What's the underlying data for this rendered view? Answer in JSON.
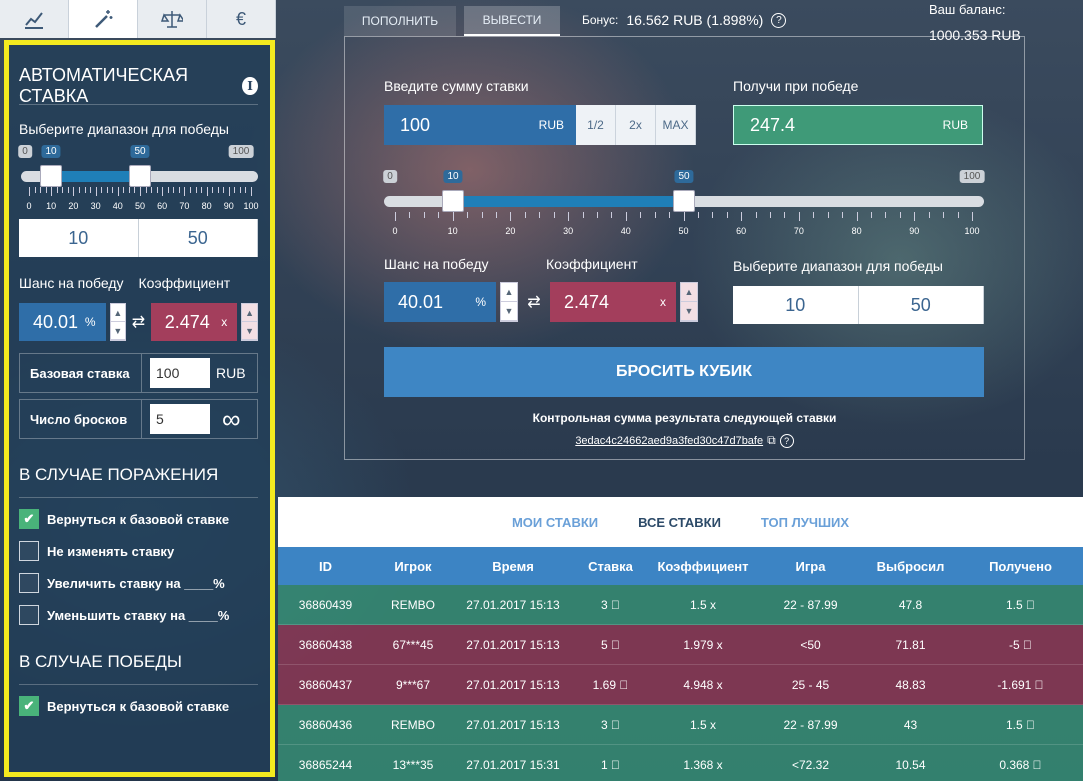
{
  "top_tabs": [
    {
      "icon": "chart-icon"
    },
    {
      "icon": "magic-wand-icon"
    },
    {
      "icon": "scales-icon"
    },
    {
      "icon": "euro-icon",
      "label": "€"
    }
  ],
  "sidebar": {
    "title": "АВТОМАТИЧЕСКАЯ СТАВКА",
    "range_label": "Выберите диапазон для победы",
    "range_min_label": "0",
    "range_max_label": "100",
    "range_low": "10",
    "range_high": "50",
    "tick_labels": [
      "0",
      "10",
      "20",
      "30",
      "40",
      "50",
      "60",
      "70",
      "80",
      "90",
      "100"
    ],
    "chance_label": "Шанс на победу",
    "coef_label": "Коэффициент",
    "chance_value": "40.01",
    "chance_unit": "%",
    "coef_value": "2.474",
    "coef_unit": "x",
    "base_bet_label": "Базовая ставка",
    "base_bet_value": "100",
    "base_bet_unit": "RUB",
    "rolls_label": "Число бросков",
    "rolls_value": "5",
    "rolls_infinity": "∞",
    "loss_title": "В СЛУЧАЕ ПОРАЖЕНИЯ",
    "loss_options": [
      {
        "label": "Вернуться к базовой ставке",
        "checked": true
      },
      {
        "label": "Не изменять ставку",
        "checked": false
      },
      {
        "label": "Увеличить ставку на ____%",
        "checked": false
      },
      {
        "label": "Уменьшить ставку на ____%",
        "checked": false
      }
    ],
    "win_title": "В СЛУЧАЕ ПОБЕДЫ",
    "win_options": [
      {
        "label": "Вернуться к базовой ставке",
        "checked": true
      }
    ]
  },
  "header": {
    "deposit": "ПОПОЛНИТЬ",
    "withdraw": "ВЫВЕСТИ",
    "bonus_label": "Бонус:",
    "bonus_value": "16.562 RUB (1.898%)",
    "help": "?",
    "balance_label": "Ваш баланс:",
    "balance_value": "1000.353 RUB"
  },
  "bet": {
    "amount_label": "Введите сумму ставки",
    "amount_value": "100",
    "amount_unit": "RUB",
    "half": "1/2",
    "double": "2x",
    "max": "MAX",
    "win_label": "Получи при победе",
    "win_value": "247.4",
    "win_unit": "RUB",
    "range_min_label": "0",
    "range_max_label": "100",
    "range_low": "10",
    "range_high": "50",
    "tick_labels": [
      "0",
      "10",
      "20",
      "30",
      "40",
      "50",
      "60",
      "70",
      "80",
      "90",
      "100"
    ],
    "chance_label": "Шанс на победу",
    "coef_label": "Коэффициент",
    "chance_value": "40.01",
    "chance_unit": "%",
    "coef_value": "2.474",
    "coef_unit": "x",
    "range_label": "Выберите диапазон для победы",
    "range_low_input": "10",
    "range_high_input": "50",
    "roll_button": "БРОСИТЬ КУБИК",
    "checksum_label": "Контрольная сумма результата следующей ставки",
    "checksum_value": "3edac4c24662aed9a3fed30c47d7bafe"
  },
  "table_tabs": [
    "МОИ СТАВКИ",
    "ВСЕ СТАВКИ",
    "ТОП ЛУЧШИХ"
  ],
  "table": {
    "columns": [
      "ID",
      "Игрок",
      "Время",
      "Ставка",
      "Коэффициент",
      "Игра",
      "Выбросил",
      "Получено"
    ],
    "rows": [
      {
        "cells": [
          "36860439",
          "REMBO",
          "27.01.2017 15:13",
          "3 ⃞",
          "1.5 x",
          "22 - 87.99",
          "47.8",
          "1.5 ⃞"
        ],
        "win": true
      },
      {
        "cells": [
          "36860438",
          "67***45",
          "27.01.2017 15:13",
          "5 ⃞",
          "1.979 x",
          "<50",
          "71.81",
          "-5 ⃞"
        ],
        "win": false
      },
      {
        "cells": [
          "36860437",
          "9***67",
          "27.01.2017 15:13",
          "1.69 ⃞",
          "4.948 x",
          "25 - 45",
          "48.83",
          "-1.691 ⃞"
        ],
        "win": false
      },
      {
        "cells": [
          "36860436",
          "REMBO",
          "27.01.2017 15:13",
          "3 ⃞",
          "1.5 x",
          "22 - 87.99",
          "43",
          "1.5 ⃞"
        ],
        "win": true
      },
      {
        "cells": [
          "36865244",
          "13***35",
          "27.01.2017 15:31",
          "1 ⃞",
          "1.368 x",
          "<72.32",
          "10.54",
          "0.368 ⃞"
        ],
        "win": true
      }
    ]
  },
  "colors": {
    "highlight": "#f4ea1f",
    "blue": "#2f6ea8",
    "red": "#a33e5c",
    "green": "#3f9a78",
    "accent": "#3e86c4"
  }
}
